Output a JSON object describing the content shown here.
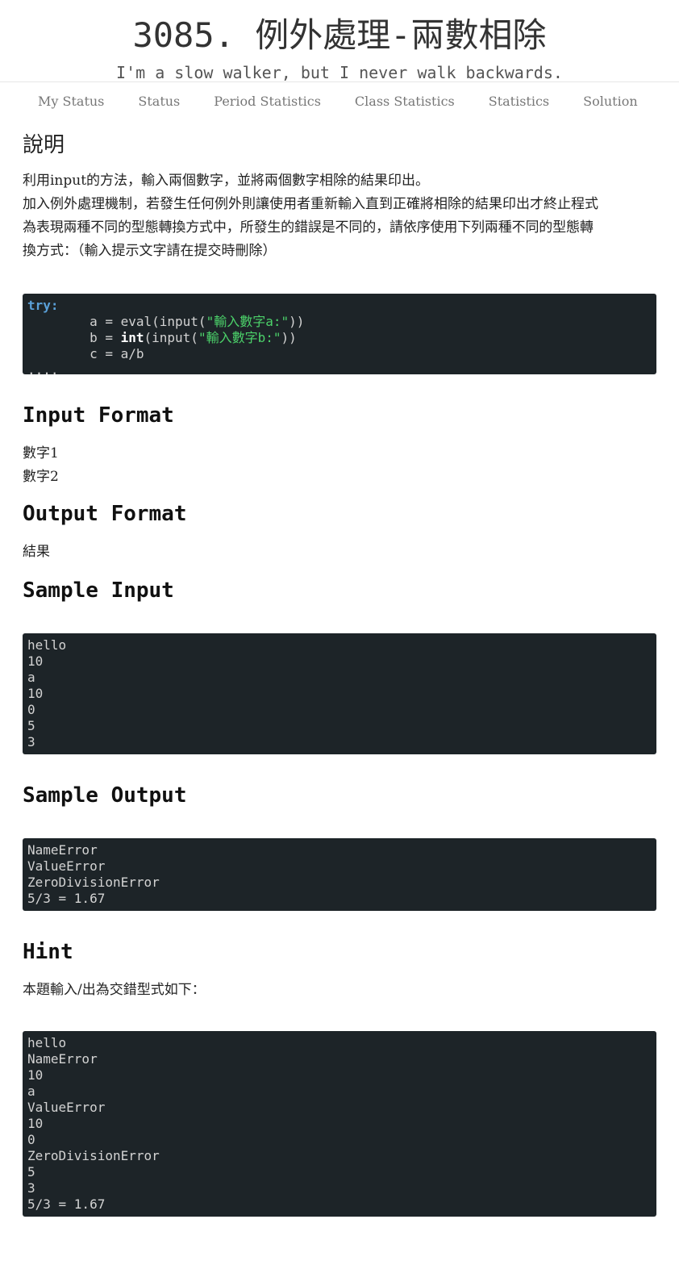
{
  "header": {
    "title": "3085. 例外處理-兩數相除",
    "motto": "I'm a slow walker, but I never walk backwards."
  },
  "nav": {
    "items": [
      "My Status",
      "Status",
      "Period Statistics",
      "Class Statistics",
      "Statistics",
      "Solution"
    ]
  },
  "description": {
    "heading": "說明",
    "lines": [
      "利用input的方法，輸入兩個數字，並將兩個數字相除的結果印出。",
      "加入例外處理機制，若發生任何例外則讓使用者重新輸入直到正確將相除的結果印出才終止程式",
      "為表現兩種不同的型態轉換方式中，所發生的錯誤是不同的，請依序使用下列兩種不同的型態轉",
      "換方式：（輸入提示文字請在提交時刪除）"
    ],
    "code": {
      "kw_try": "try",
      "colon": ":",
      "line_a_pre": "        a = eval(input(",
      "line_a_str": "\"輸入數字a:\"",
      "line_a_post": "))",
      "line_b_pre": "        b = ",
      "line_b_int": "int",
      "line_b_mid": "(input(",
      "line_b_str": "\"輸入數字b:\"",
      "line_b_post": "))",
      "line_c": "        c = a/b",
      "line_dots": "...."
    }
  },
  "input_format": {
    "heading": "Input Format",
    "lines": [
      "數字1",
      "數字2"
    ]
  },
  "output_format": {
    "heading": "Output Format",
    "lines": [
      "結果"
    ]
  },
  "sample_input": {
    "heading": "Sample Input",
    "text": "hello\n10\na\n10\n0\n5\n3"
  },
  "sample_output": {
    "heading": "Sample Output",
    "text": "NameError\nValueError\nZeroDivisionError\n5/3 = 1.67"
  },
  "hint": {
    "heading": "Hint",
    "text": "本題輸入/出為交錯型式如下：",
    "code": "hello\nNameError\n10\na\nValueError\n10\n0\nZeroDivisionError\n5\n3\n5/3 = 1.67"
  },
  "colors": {
    "code_bg": "#1d2428",
    "code_text": "#d3d3d3",
    "keyword": "#5aa0d8",
    "string": "#4cd26a",
    "nav_text": "#777777"
  }
}
